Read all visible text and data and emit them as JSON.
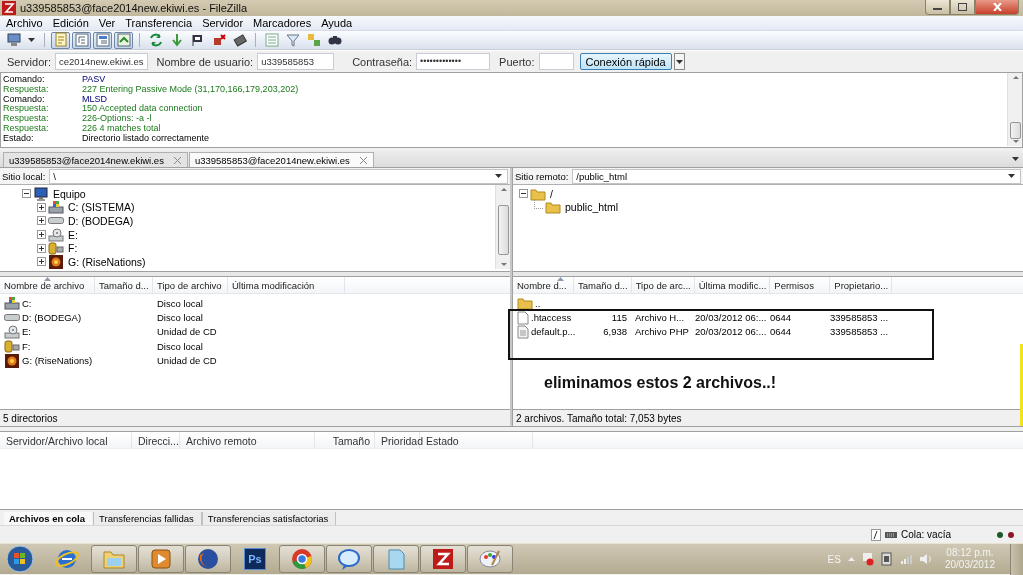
{
  "window": {
    "title": "u339585853@face2014new.ekiwi.es - FileZilla"
  },
  "menu": [
    "Archivo",
    "Edición",
    "Ver",
    "Transferencia",
    "Servidor",
    "Marcadores",
    "Ayuda"
  ],
  "toolbar": [
    [
      {
        "kind": "sites",
        "pressed": false
      }
    ],
    [
      {
        "kind": "log",
        "pressed": true
      },
      {
        "kind": "localtree",
        "pressed": true
      },
      {
        "kind": "remotetree",
        "pressed": true
      },
      {
        "kind": "queue",
        "pressed": true
      }
    ],
    [
      {
        "kind": "refresh",
        "pressed": false
      },
      {
        "kind": "process",
        "pressed": false
      },
      {
        "kind": "cancel",
        "pressed": false
      },
      {
        "kind": "disconnect",
        "pressed": false
      },
      {
        "kind": "reconnect",
        "pressed": false
      }
    ],
    [
      {
        "kind": "listing",
        "pressed": false
      },
      {
        "kind": "filter",
        "pressed": false
      },
      {
        "kind": "compare",
        "pressed": false
      },
      {
        "kind": "search",
        "pressed": false
      }
    ]
  ],
  "quickconnect": {
    "host_label": "Servidor:",
    "host": "ce2014new.ekiwi.es",
    "user_label": "Nombre de usuario:",
    "user": "u339585853",
    "password_label": "Contraseña:",
    "password": "•••••••••••••",
    "port_label": "Puerto:",
    "button": "Conexión rápida"
  },
  "log": [
    {
      "kind": "command",
      "label": "Comando:",
      "text": "PASV"
    },
    {
      "kind": "response",
      "label": "Respuesta:",
      "text": "227 Entering Passive Mode (31,170,166,179,203,202)"
    },
    {
      "kind": "command",
      "label": "Comando:",
      "text": "MLSD"
    },
    {
      "kind": "response",
      "label": "Respuesta:",
      "text": "150 Accepted data connection"
    },
    {
      "kind": "response",
      "label": "Respuesta:",
      "text": "226-Options: -a -l"
    },
    {
      "kind": "response",
      "label": "Respuesta:",
      "text": "226 4 matches total"
    },
    {
      "kind": "status",
      "label": "Estado:",
      "text": "Directorio listado correctamente"
    }
  ],
  "tabs": [
    {
      "label": "u339585853@face2014new.ekiwi.es",
      "selected": false
    },
    {
      "label": "u339585853@face2014new.ekiwi.es",
      "selected": true
    }
  ],
  "local": {
    "site_label": "Sitio local:",
    "path": "\\",
    "tree": [
      {
        "label": "Equipo",
        "kind": "computer",
        "expanded": true,
        "children": [
          {
            "label": "C: (SISTEMA)",
            "kind": "system",
            "expanded": false
          },
          {
            "label": "D: (BODEGA)",
            "kind": "disk",
            "expanded": false
          },
          {
            "label": "E:",
            "kind": "cd",
            "expanded": false
          },
          {
            "label": "F:",
            "kind": "usb",
            "expanded": false
          },
          {
            "label": "G: (RiseNations)",
            "kind": "game",
            "expanded": false
          }
        ]
      }
    ],
    "columns": [
      {
        "label": "Nombre de archivo",
        "sorted": true
      },
      {
        "label": "Tamaño d...",
        "sorted": false
      },
      {
        "label": "Tipo de archivo",
        "sorted": false
      },
      {
        "label": "Última modificación",
        "sorted": false
      }
    ],
    "rows": [
      {
        "kind": "system",
        "name": "C:",
        "type": "Disco local"
      },
      {
        "kind": "disk",
        "name": "D: (BODEGA)",
        "type": "Disco local"
      },
      {
        "kind": "cd",
        "name": "E:",
        "type": "Unidad de CD"
      },
      {
        "kind": "usb",
        "name": "F:",
        "type": "Disco local"
      },
      {
        "kind": "game",
        "name": "G: (RiseNations)",
        "type": "Unidad de CD"
      }
    ],
    "status": "5 directorios"
  },
  "remote": {
    "site_label": "Sitio remoto:",
    "path": "/public_html",
    "tree": [
      {
        "label": "/",
        "expanded": true,
        "children": [
          {
            "label": "public_html"
          }
        ]
      }
    ],
    "columns": [
      {
        "label": "Nombre d...",
        "sorted": true
      },
      {
        "label": "Tamaño d...",
        "sorted": false
      },
      {
        "label": "Tipo de arc...",
        "sorted": false
      },
      {
        "label": "Última modific...",
        "sorted": false
      },
      {
        "label": "Permisos",
        "sorted": false
      },
      {
        "label": "Propietario...",
        "sorted": false
      }
    ],
    "rows": [
      {
        "kind": "folder",
        "name": ".."
      },
      {
        "kind": "file",
        "name": ".htaccess",
        "size": "115",
        "type": "Archivo H...",
        "modified": "20/03/2012 06:...",
        "permissions": "0644",
        "owner": "339585853 ..."
      },
      {
        "kind": "php",
        "name": "default.p...",
        "size": "6,938",
        "type": "Archivo PHP",
        "modified": "20/03/2012 06:...",
        "permissions": "0644",
        "owner": "339585853 ..."
      }
    ],
    "status": "2 archivos. Tamaño total: 7,053 bytes"
  },
  "annotation": {
    "text": "eliminamos estos 2 archivos..!"
  },
  "queue": {
    "columns": [
      "Servidor/Archivo local",
      "Direcci...",
      "Archivo remoto",
      "Tamaño",
      "Prioridad",
      "Estado"
    ],
    "tabs": [
      {
        "label": "Archivos en cola",
        "selected": true
      },
      {
        "label": "Transferencias fallidas",
        "selected": false
      },
      {
        "label": "Transferencias satisfactorias",
        "selected": false
      }
    ]
  },
  "status_bar": {
    "queue": "Cola: vacía"
  },
  "taskbar": {
    "apps": [
      {
        "kind": "globe",
        "running": false
      },
      {
        "kind": "folders",
        "running": true
      },
      {
        "kind": "player",
        "running": true
      },
      {
        "kind": "foxglobe",
        "running": true
      },
      {
        "kind": "ps",
        "label": "Ps",
        "running": false
      },
      {
        "kind": "wheel",
        "running": true
      },
      {
        "kind": "bubble",
        "running": true
      },
      {
        "kind": "notepad",
        "running": true
      },
      {
        "kind": "zigzag",
        "running": true
      },
      {
        "kind": "palette",
        "running": true
      }
    ],
    "language": "ES",
    "time": "08:12 p.m.",
    "date": "20/03/2012"
  }
}
